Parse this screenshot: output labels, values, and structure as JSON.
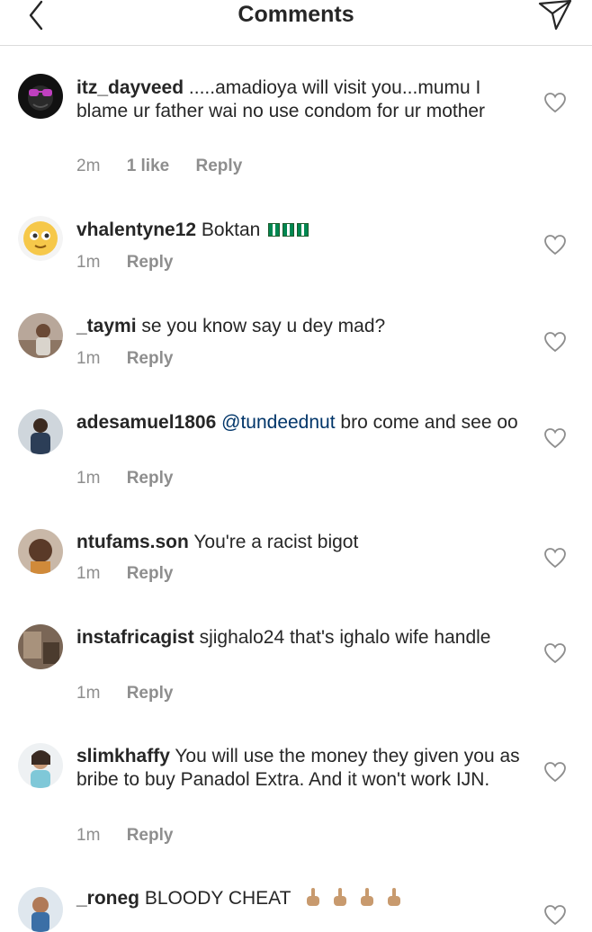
{
  "header": {
    "title": "Comments",
    "back_icon": "chevron-left-icon",
    "send_icon": "paper-plane-icon"
  },
  "colors": {
    "text": "#262626",
    "meta": "#8e8e8e",
    "mention": "#003569",
    "divider": "#dbdbdb",
    "flag_green": "#008751"
  },
  "comments": [
    {
      "username": "itz_dayveed",
      "text": ".....amadioya will visit you...mumu I blame ur father wai no use condom for ur mother",
      "time": "2m",
      "likes": "1 like",
      "reply": "Reply"
    },
    {
      "username": "vhalentyne12",
      "text": "Boktan",
      "emoji": "nigeria-flag x3",
      "time": "1m",
      "reply": "Reply"
    },
    {
      "username": "_taymi",
      "text": "se you know say u dey mad?",
      "time": "1m",
      "reply": "Reply"
    },
    {
      "username": "adesamuel1806",
      "mention": "@tundeednut",
      "text": "bro come and see oo",
      "time": "1m",
      "reply": "Reply"
    },
    {
      "username": "ntufams.son",
      "text": "You're a racist bigot",
      "time": "1m",
      "reply": "Reply"
    },
    {
      "username": "instafricagist",
      "text": "sjighalo24 that's ighalo wife handle",
      "time": "1m",
      "reply": "Reply"
    },
    {
      "username": "slimkhaffy",
      "text": "You will use the money they given you as bribe to buy Panadol Extra. And it won't work IJN.",
      "time": "1m",
      "reply": "Reply"
    },
    {
      "username": "_roneg",
      "text": "BLOODY CHEAT",
      "emoji": "middle-finger x4"
    }
  ]
}
